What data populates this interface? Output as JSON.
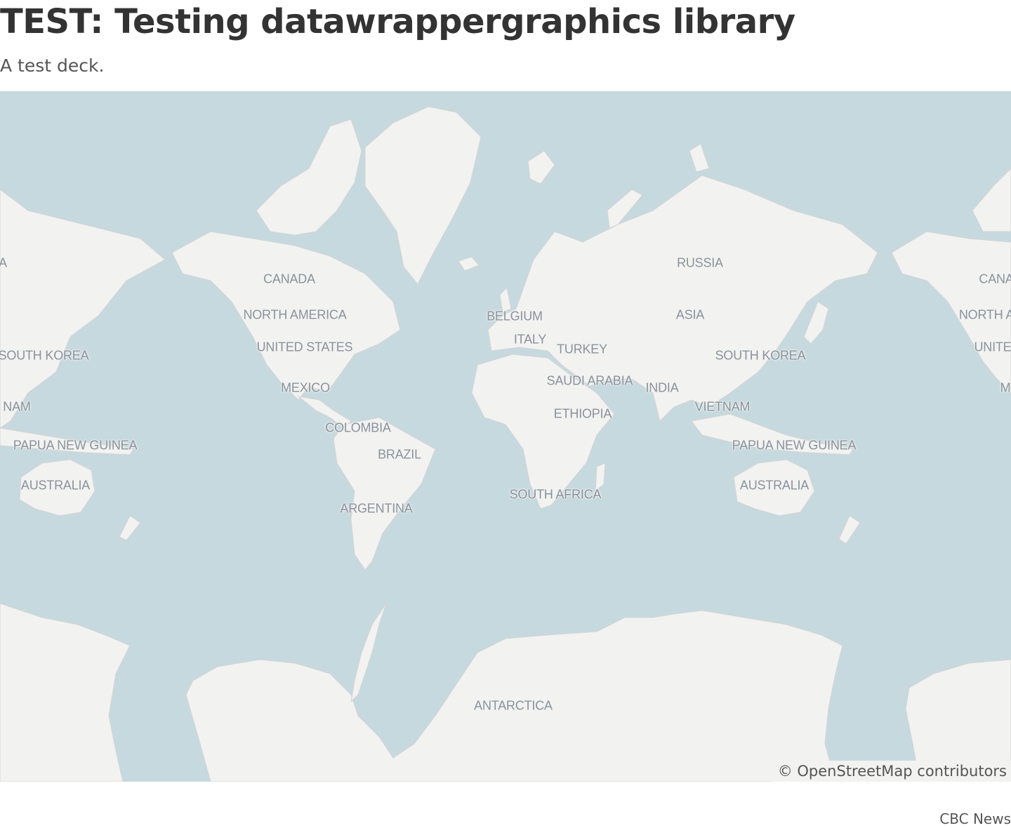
{
  "header": {
    "title": "TEST: Testing datawrappergraphics library",
    "deck": "A test deck."
  },
  "map": {
    "colors": {
      "water": "#c6d9df",
      "land": "#f2f2f1",
      "label": "#8a939b"
    },
    "labels": [
      {
        "text": "RUSSIA"
      },
      {
        "text": "CANADA"
      },
      {
        "text": "NORTH AMERICA"
      },
      {
        "text": "UNITED STATES"
      },
      {
        "text": "MEXICO"
      },
      {
        "text": "COLOMBIA"
      },
      {
        "text": "BRAZIL"
      },
      {
        "text": "ARGENTINA"
      },
      {
        "text": "BELGIUM"
      },
      {
        "text": "ITALY"
      },
      {
        "text": "TURKEY"
      },
      {
        "text": "SAUDI ARABIA"
      },
      {
        "text": "INDIA"
      },
      {
        "text": "ASIA"
      },
      {
        "text": "ETHIOPIA"
      },
      {
        "text": "SOUTH AFRICA"
      },
      {
        "text": "SOUTH KOREA"
      },
      {
        "text": "VIETNAM"
      },
      {
        "text": "PAPUA NEW GUINEA"
      },
      {
        "text": "AUSTRALIA"
      },
      {
        "text": "ANTARCTICA"
      },
      {
        "text": "SOUTH KOREA"
      },
      {
        "text": "NAM"
      },
      {
        "text": "PAPUA NEW GUINEA"
      },
      {
        "text": "AUSTRALIA"
      },
      {
        "text": "A"
      },
      {
        "text": "CANA"
      },
      {
        "text": "NORTH A"
      },
      {
        "text": "UNITE"
      },
      {
        "text": "M"
      }
    ],
    "attribution": "© OpenStreetMap contributors"
  },
  "footer": {
    "byline": "CBC News"
  }
}
